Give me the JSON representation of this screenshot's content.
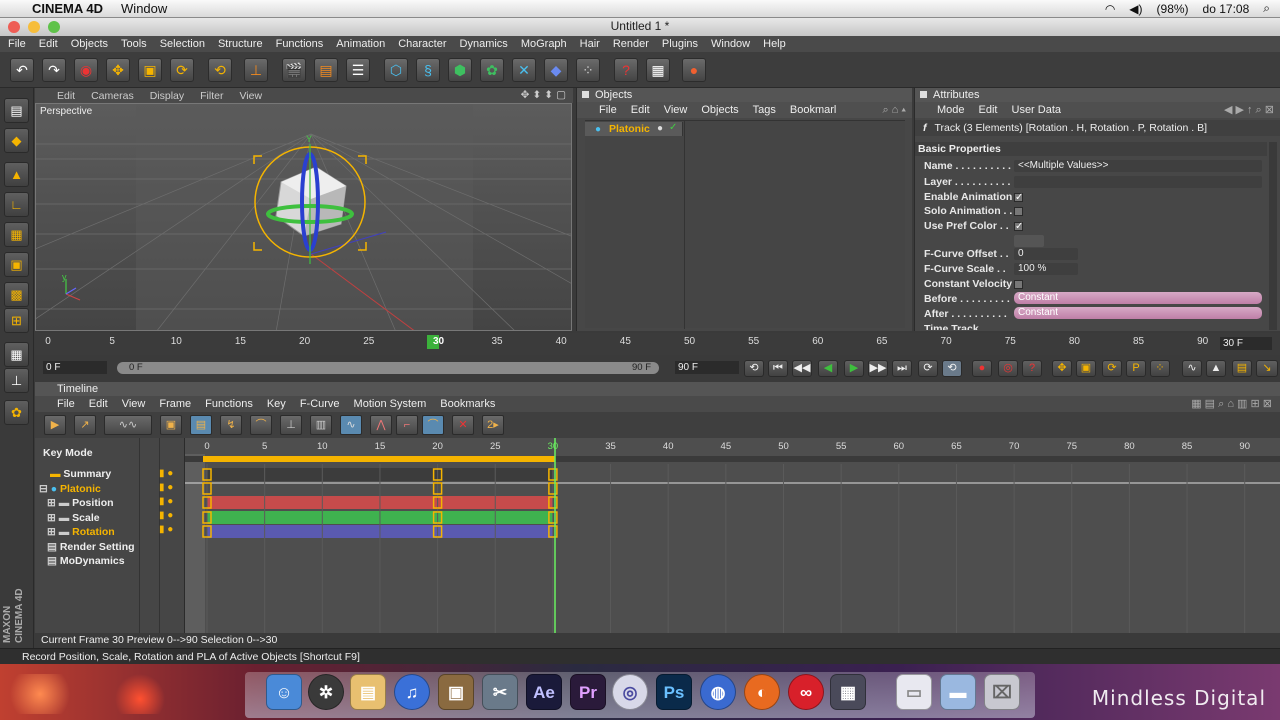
{
  "mac_menubar": {
    "app": "CINEMA 4D",
    "window_menu": "Window",
    "battery": "(98%)",
    "clock": "do 17:08"
  },
  "window": {
    "title": "Untitled 1 *"
  },
  "main_menu": [
    "File",
    "Edit",
    "Objects",
    "Tools",
    "Selection",
    "Structure",
    "Functions",
    "Animation",
    "Character",
    "Dynamics",
    "MoGraph",
    "Hair",
    "Render",
    "Plugins",
    "Window",
    "Help"
  ],
  "viewport": {
    "menu": [
      "Edit",
      "Cameras",
      "Display",
      "Filter",
      "View"
    ],
    "label": "Perspective"
  },
  "objects_panel": {
    "title": "Objects",
    "menu": [
      "File",
      "Edit",
      "View",
      "Objects",
      "Tags",
      "Bookmarl"
    ],
    "object_name": "Platonic"
  },
  "attributes": {
    "title": "Attributes",
    "menu": [
      "Mode",
      "Edit",
      "User Data"
    ],
    "track_header": "Track (3 Elements) [Rotation . H, Rotation . P, Rotation . B]",
    "section": "Basic Properties",
    "rows": [
      {
        "label": "Name . . . . . . . . . .",
        "value": "<<Multiple Values>>"
      },
      {
        "label": "Layer . . . . . . . . . .",
        "value": ""
      },
      {
        "label": "Enable Animation",
        "value": "✓"
      },
      {
        "label": "Solo Animation . .",
        "value": ""
      },
      {
        "label": "Use Pref Color . .",
        "value": "✓"
      },
      {
        "label": "F-Curve Offset . .",
        "value": "0"
      },
      {
        "label": "F-Curve Scale . .",
        "value": "100 %"
      },
      {
        "label": "Constant Velocity",
        "value": ""
      },
      {
        "label": "Before . . . . . . . . .",
        "value": "Constant"
      },
      {
        "label": "After . . . . . . . . . .",
        "value": "Constant"
      },
      {
        "label": "Time Track",
        "value": ""
      }
    ]
  },
  "ruler": {
    "ticks": [
      "0",
      "5",
      "10",
      "15",
      "20",
      "25",
      "30",
      "35",
      "40",
      "45",
      "50",
      "55",
      "60",
      "65",
      "70",
      "75",
      "80",
      "85",
      "90"
    ],
    "current_frame": "30",
    "frame_display": "30 F"
  },
  "range": {
    "start": "0 F",
    "min": "0 F",
    "max": "90 F",
    "end": "90 F"
  },
  "timeline": {
    "title": "Timeline",
    "menu": [
      "File",
      "Edit",
      "View",
      "Frame",
      "Functions",
      "Key",
      "F-Curve",
      "Motion System",
      "Bookmarks"
    ],
    "key_mode": "Key Mode",
    "ticks": [
      "0",
      "5",
      "10",
      "15",
      "20",
      "25",
      "30",
      "35",
      "40",
      "45",
      "50",
      "55",
      "60",
      "65",
      "70",
      "75",
      "80",
      "85",
      "90"
    ],
    "tracks": [
      "Summary",
      "Platonic",
      "Position",
      "Scale",
      "Rotation",
      "Render Setting",
      "MoDynamics"
    ],
    "keyframes": [
      0,
      20,
      30
    ]
  },
  "status": {
    "frame_info": "Current Frame  30   Preview  0-->90      Selection  0-->30",
    "hint": "Record Position, Scale, Rotation and PLA of Active Objects [Shortcut F9]"
  },
  "side_label": "MAXON CINEMA 4D",
  "dock": {
    "icons": [
      "finder-icon",
      "safari-icon",
      "notes-icon",
      "itunes-icon",
      "iphoto-icon",
      "preview-icon",
      "after-effects-icon",
      "premiere-icon",
      "cinema4d-icon",
      "photoshop-icon",
      "globe-icon",
      "firefox-icon",
      "lastfm-icon",
      "photobooth-icon",
      "documents-icon",
      "folder-icon",
      "trash-icon"
    ],
    "ae": "Ae",
    "pr": "Pr",
    "ps": "Ps",
    "brand": "Mindless Digital"
  },
  "colors": {
    "accent": "#f5b400",
    "position_track": "#c64b4b",
    "scale_track": "#3fb24f",
    "rotation_track": "#5a5ab0",
    "playhead": "#6af060"
  }
}
